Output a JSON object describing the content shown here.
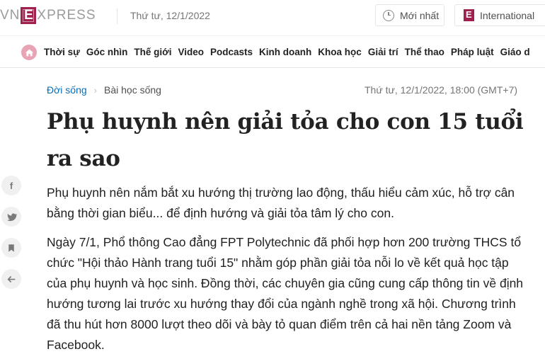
{
  "header": {
    "logo_vn": "VN",
    "logo_e": "E",
    "logo_rest": "XPRESS",
    "date": "Thứ tư, 12/1/2022",
    "latest_label": "Mới nhất",
    "international_label": "International"
  },
  "nav": {
    "items": [
      "Thời sự",
      "Góc nhìn",
      "Thế giới",
      "Video",
      "Podcasts",
      "Kinh doanh",
      "Khoa học",
      "Giải trí",
      "Thể thao",
      "Pháp luật",
      "Giáo d"
    ]
  },
  "article": {
    "category": "Đời sống",
    "subcategory": "Bài học sống",
    "datetime": "Thứ tư, 12/1/2022, 18:00 (GMT+7)",
    "title": "Phụ huynh nên giải tỏa cho con 15 tuổi ra sao",
    "lead": "Phụ huynh nên nắm bắt xu hướng thị trường lao động, thấu hiểu cảm xúc, hỗ trợ cân bằng thời gian biểu... để định hướng và giải tỏa tâm lý cho con.",
    "paragraph": "Ngày 7/1, Phổ thông Cao đẳng FPT Polytechnic đã phối hợp hơn 200 trường THCS tổ chức \"Hội thảo Hành trang tuổi 15\" nhằm góp phần giải tỏa nỗi lo về kết quả học tập của phụ huynh và học sinh. Đồng thời, các chuyên gia cũng cung cấp thông tin về định hướng tương lai trước xu hướng thay đổi của ngành nghề trong xã hội. Chương trình đã thu hút hơn 8000 lượt theo dõi và bày tỏ quan điểm trên cả hai nền tảng Zoom và Facebook."
  },
  "social": {
    "facebook_glyph": "f",
    "twitter_glyph": "t",
    "bookmark_glyph": "▮",
    "back_glyph": "←"
  },
  "colors": {
    "brand": "#9f224e",
    "link": "#076db6"
  }
}
